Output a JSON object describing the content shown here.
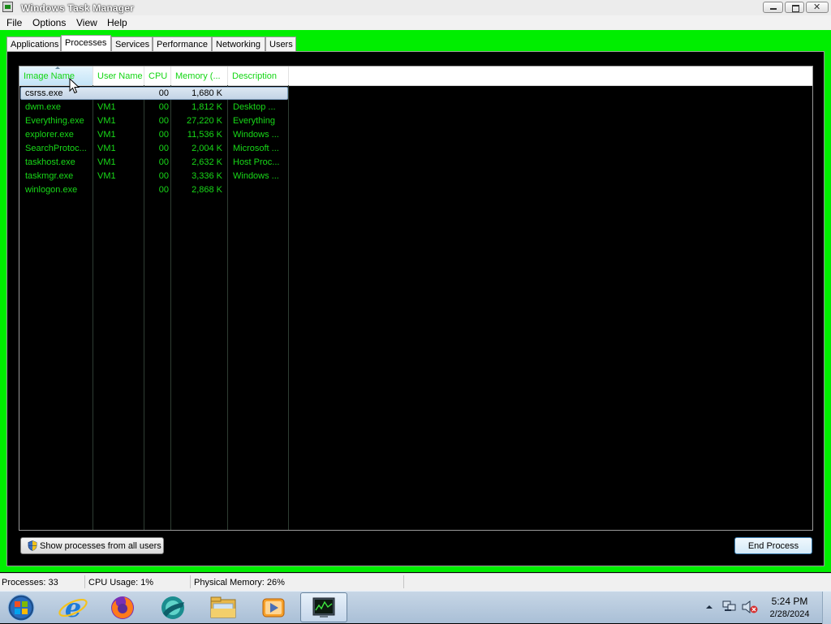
{
  "window": {
    "title": "Windows Task Manager"
  },
  "menu": {
    "items": [
      "File",
      "Options",
      "View",
      "Help"
    ]
  },
  "tabs": [
    {
      "label": "Applications",
      "active": false
    },
    {
      "label": "Processes",
      "active": true
    },
    {
      "label": "Services",
      "active": false
    },
    {
      "label": "Performance",
      "active": false
    },
    {
      "label": "Networking",
      "active": false
    },
    {
      "label": "Users",
      "active": false
    }
  ],
  "processes": {
    "columns": [
      "Image Name",
      "User Name",
      "CPU",
      "Memory (...",
      "Description"
    ],
    "sorted_column": "Image Name",
    "rows": [
      {
        "image": "csrss.exe",
        "user": "",
        "cpu": "00",
        "memory": "1,680 K",
        "description": "",
        "selected": true
      },
      {
        "image": "dwm.exe",
        "user": "VM1",
        "cpu": "00",
        "memory": "1,812 K",
        "description": "Desktop ..."
      },
      {
        "image": "Everything.exe",
        "user": "VM1",
        "cpu": "00",
        "memory": "27,220 K",
        "description": "Everything"
      },
      {
        "image": "explorer.exe",
        "user": "VM1",
        "cpu": "00",
        "memory": "11,536 K",
        "description": "Windows ..."
      },
      {
        "image": "SearchProtoc...",
        "user": "VM1",
        "cpu": "00",
        "memory": "2,004 K",
        "description": "Microsoft ..."
      },
      {
        "image": "taskhost.exe",
        "user": "VM1",
        "cpu": "00",
        "memory": "2,632 K",
        "description": "Host Proc..."
      },
      {
        "image": "taskmgr.exe",
        "user": "VM1",
        "cpu": "00",
        "memory": "3,336 K",
        "description": "Windows ..."
      },
      {
        "image": "winlogon.exe",
        "user": "",
        "cpu": "00",
        "memory": "2,868 K",
        "description": ""
      }
    ]
  },
  "buttons": {
    "show_all": "Show processes from all users",
    "end_process": "End Process"
  },
  "status": {
    "processes": "Processes: 33",
    "cpu": "CPU Usage: 1%",
    "memory": "Physical Memory: 26%"
  },
  "taskbar": {
    "apps": [
      "start-orb-icon",
      "internet-explorer-icon",
      "firefox-icon",
      "browser-app-icon",
      "file-explorer-icon",
      "media-player-icon",
      "task-manager-icon"
    ],
    "time": "5:24 PM",
    "date": "2/28/2024"
  },
  "colors": {
    "list_text": "#18d818",
    "frame_green": "#00ee00",
    "background": "#000000"
  }
}
